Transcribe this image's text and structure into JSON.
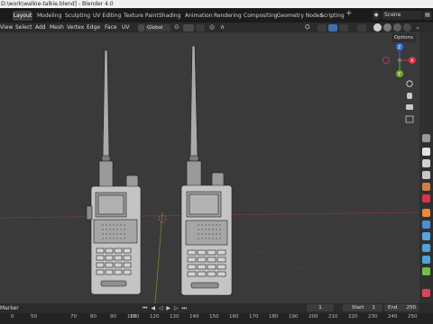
{
  "window": {
    "title": "D:\\work\\walkie-talkie.blend] - Blender 4.0"
  },
  "workspace_tabs": [
    {
      "label": "Layout",
      "active": true
    },
    {
      "label": "Modeling"
    },
    {
      "label": "Sculpting"
    },
    {
      "label": "UV Editing"
    },
    {
      "label": "Texture Paint"
    },
    {
      "label": "Shading"
    },
    {
      "label": "Animation"
    },
    {
      "label": "Rendering"
    },
    {
      "label": "Compositing"
    },
    {
      "label": "Geometry Nodes"
    },
    {
      "label": "Scripting"
    }
  ],
  "add_tab_label": "+",
  "scene": {
    "label": "Scene"
  },
  "menu": [
    "View",
    "Select",
    "Add",
    "Mesh",
    "Vertex",
    "Edge",
    "Face",
    "UV"
  ],
  "transform_orientation": "Global",
  "viewport": {
    "options_label": "Options",
    "colors": {
      "background": "#3a3a3a",
      "grid": "#454545",
      "x_axis": "#8b3b3b",
      "y_axis": "#7a9a3a"
    }
  },
  "gizmo": {
    "axes": [
      {
        "label": "Z",
        "color": "#2f6fd6"
      },
      {
        "label": "X",
        "color": "#d1344a"
      },
      {
        "label": "Y",
        "color": "#6fa82d"
      }
    ],
    "nav_icons": [
      "zoom-icon",
      "hand-icon",
      "camera-icon",
      "grid-icon"
    ]
  },
  "timeline": {
    "marker_label": "Marker",
    "current_frame": "1",
    "start_label": "Start",
    "start_value": "1",
    "end_label": "End",
    "end_value": "250",
    "ruler": [
      "0",
      "50",
      "70",
      "80",
      "90",
      "100",
      "110",
      "120",
      "130",
      "140",
      "150",
      "160",
      "170",
      "180",
      "190",
      "200",
      "210",
      "220",
      "230",
      "240",
      "250"
    ]
  },
  "sidebar_icons": [
    {
      "name": "tool-icon",
      "color": "#9a9a9a"
    },
    {
      "name": "render-icon",
      "color": "#e2e2e2"
    },
    {
      "name": "output-icon",
      "color": "#d0d0d0"
    },
    {
      "name": "view-layer-icon",
      "color": "#c9c9c9"
    },
    {
      "name": "scene-icon",
      "color": "#cf7b4b"
    },
    {
      "name": "world-icon",
      "color": "#d9344b"
    },
    {
      "name": "object-icon",
      "color": "#e58a3a"
    },
    {
      "name": "modifier-icon",
      "color": "#4f8cd6"
    },
    {
      "name": "particles-icon",
      "color": "#58a5dd"
    },
    {
      "name": "physics-icon",
      "color": "#4fa3d8"
    },
    {
      "name": "constraints-icon",
      "color": "#4fa3d8"
    },
    {
      "name": "data-icon",
      "color": "#6cc04a"
    },
    {
      "name": "material-icon",
      "color": "#d6455a"
    }
  ]
}
